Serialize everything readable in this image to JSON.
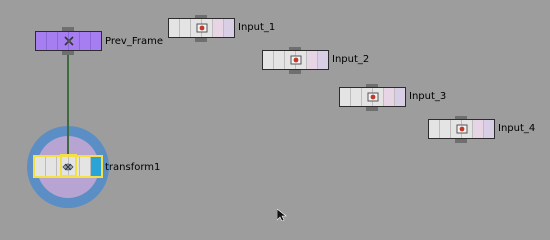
{
  "nodes": {
    "prev_frame": {
      "label": "Prev_Frame"
    },
    "input_1": {
      "label": "Input_1"
    },
    "input_2": {
      "label": "Input_2"
    },
    "input_3": {
      "label": "Input_3"
    },
    "input_4": {
      "label": "Input_4"
    },
    "transform1": {
      "label": "transform1"
    }
  },
  "colors": {
    "background": "#9d9d9d",
    "input_node": "#e4e4e4",
    "prev_frame_node": "#a67ef2",
    "selected_outline": "#f2e046",
    "viewer_ring_outer": "#5a8ec4",
    "viewer_ring_inner": "#b7a4d3",
    "connection_wire": "#3e6a40"
  },
  "icons": {
    "prev_frame": "shuffle-icon",
    "input": "image-input-icon",
    "transform": "transform-icon",
    "cursor": "mouse-pointer-icon"
  }
}
